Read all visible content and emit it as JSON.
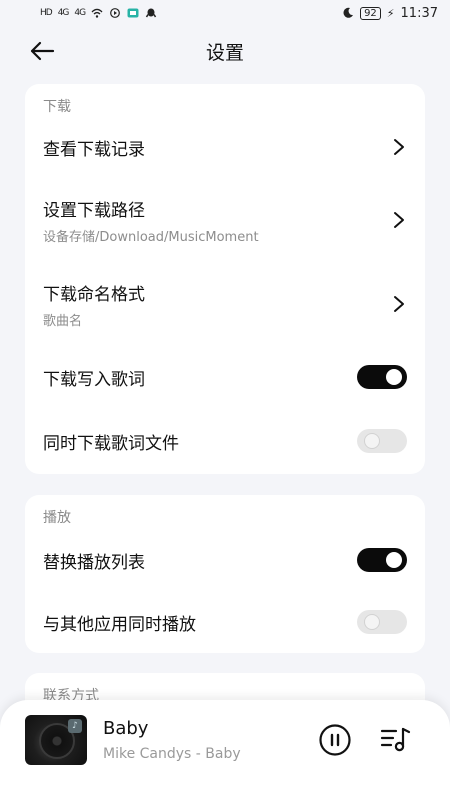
{
  "status_bar": {
    "left_signals": [
      "HD",
      "4G",
      "4G"
    ],
    "battery": "92",
    "time": "11:37"
  },
  "header": {
    "title": "设置"
  },
  "sections": {
    "download": {
      "title": "下载",
      "view_records": {
        "label": "查看下载记录"
      },
      "download_path": {
        "label": "设置下载路径",
        "value": "设备存储/Download/MusicMoment"
      },
      "naming_format": {
        "label": "下载命名格式",
        "value": "歌曲名"
      },
      "write_lyrics": {
        "label": "下载写入歌词",
        "enabled": true
      },
      "lyrics_file": {
        "label": "同时下载歌词文件",
        "enabled": false
      }
    },
    "playback": {
      "title": "播放",
      "replace_playlist": {
        "label": "替换播放列表",
        "enabled": true
      },
      "mix_with_others": {
        "label": "与其他应用同时播放",
        "enabled": false
      }
    },
    "contact": {
      "title": "联系方式"
    }
  },
  "player": {
    "title": "Baby",
    "subtitle": "Mike Candys - Baby"
  },
  "colors": {
    "background": "#f4f5f9",
    "card": "#ffffff",
    "toggle_on": "#0b0b0b",
    "toggle_off": "#e6e6e6",
    "secondary_text": "#8d8d8d"
  },
  "icons": {
    "back": "back-arrow-icon",
    "chevron": "chevron-right-icon",
    "pause": "pause-icon",
    "playlist": "playlist-icon"
  }
}
